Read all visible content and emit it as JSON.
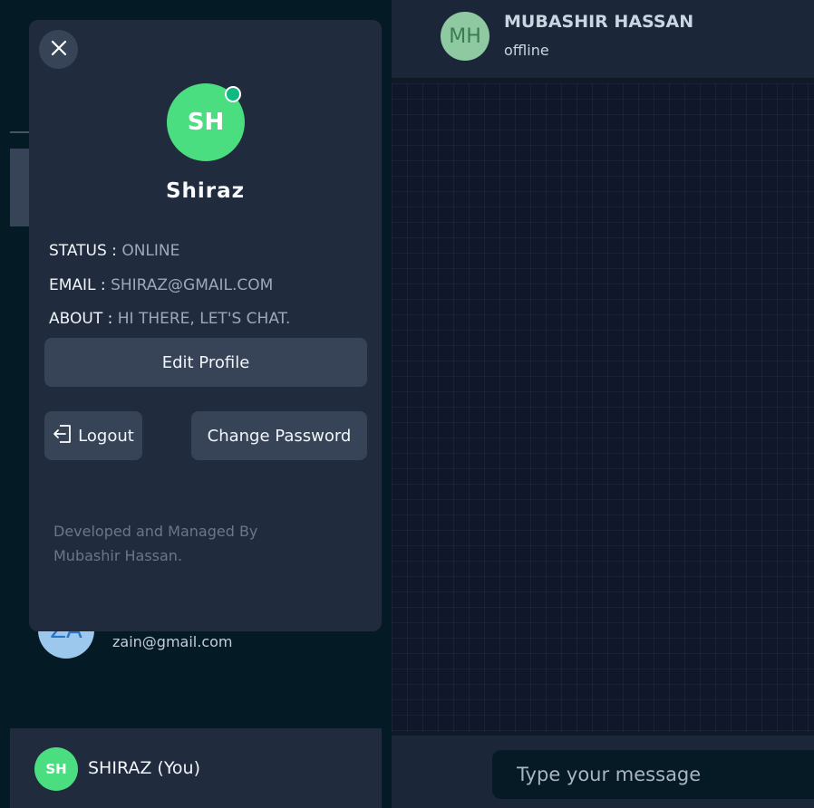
{
  "chat": {
    "contact_initials": "MH",
    "contact_name": "MUBASHIR HASSAN",
    "contact_status": "offline",
    "input_placeholder": "Type your message"
  },
  "sidebar": {
    "contact_initials": "ZA",
    "contact_email": "zain@gmail.com",
    "me_initials": "SH",
    "me_label": "SHIRAZ (You)"
  },
  "profile": {
    "initials": "SH",
    "name": "Shiraz",
    "status_label": "STATUS :",
    "status_value": "ONLINE",
    "email_label": "EMAIL :",
    "email_value": "SHIRAZ@GMAIL.COM",
    "about_label": "ABOUT :",
    "about_value": "HI THERE, LET'S CHAT.",
    "edit_label": "Edit Profile",
    "logout_label": "Logout",
    "change_password_label": "Change Password",
    "credit_line1": "Developed and Managed By",
    "credit_line2": "Mubashir Hassan."
  },
  "colors": {
    "accent_green": "#4ade80",
    "online_indicator": "#10b981",
    "panel": "#202b3d",
    "button": "#374457"
  },
  "icons": [
    "close-icon",
    "logout-icon"
  ]
}
